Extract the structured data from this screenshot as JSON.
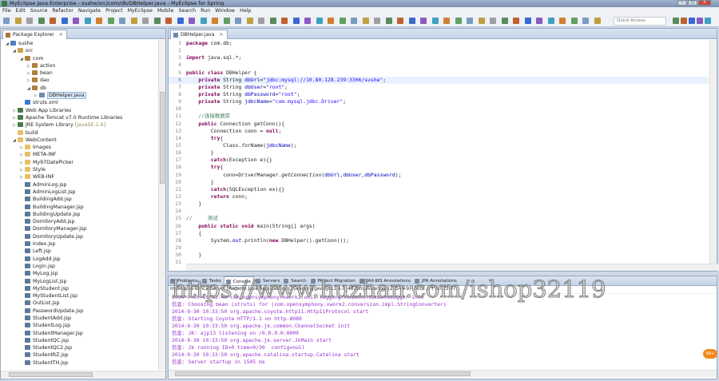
{
  "window": {
    "title": "MyEclipse Java Enterprise - sushe/src/com/db/DBHelper.java - MyEclipse for Spring"
  },
  "menu": [
    "File",
    "Edit",
    "Source",
    "Refactor",
    "Navigate",
    "Project",
    "MyEclipse",
    "Mobile",
    "Search",
    "Run",
    "Window",
    "Help"
  ],
  "toolbar": {
    "quick_access_placeholder": "Quick Access"
  },
  "package_explorer": {
    "tab": "Package Explorer",
    "nodes": [
      {
        "label": "sushe",
        "depth": 0,
        "tw": "◢",
        "icon": "project",
        "color": "#4a7fc0"
      },
      {
        "label": "src",
        "depth": 1,
        "tw": "◢",
        "icon": "source-folder",
        "color": "#c8a050"
      },
      {
        "label": "com",
        "depth": 2,
        "tw": "◢",
        "icon": "package",
        "color": "#b08040"
      },
      {
        "label": "action",
        "depth": 3,
        "tw": "▷",
        "icon": "package",
        "color": "#b08040"
      },
      {
        "label": "bean",
        "depth": 3,
        "tw": "▷",
        "icon": "package",
        "color": "#b08040"
      },
      {
        "label": "dao",
        "depth": 3,
        "tw": "▷",
        "icon": "package",
        "color": "#b08040"
      },
      {
        "label": "db",
        "depth": 3,
        "tw": "◢",
        "icon": "package",
        "color": "#b08040"
      },
      {
        "label": "DBHelper.java",
        "depth": 4,
        "tw": "▷",
        "icon": "java-file",
        "color": "#6a8ab0",
        "selected": true
      },
      {
        "label": "struts.xml",
        "depth": 2,
        "tw": "",
        "icon": "xml-file",
        "color": "#3a7ad0"
      },
      {
        "label": "Web App Libraries",
        "depth": 1,
        "tw": "▷",
        "icon": "library",
        "color": "#4a7a4a"
      },
      {
        "label": "Apache Tomcat v7.0 Runtime Libraries",
        "depth": 1,
        "tw": "▷",
        "icon": "library",
        "color": "#4a7a4a"
      },
      {
        "label": "JRE System Library",
        "extra": "[JavaSE-1.6]",
        "depth": 1,
        "tw": "▷",
        "icon": "library",
        "color": "#4a7a4a"
      },
      {
        "label": "build",
        "depth": 1,
        "tw": "",
        "icon": "folder",
        "color": "#e8c060"
      },
      {
        "label": "WebContent",
        "depth": 1,
        "tw": "◢",
        "icon": "folder",
        "color": "#e8c060"
      },
      {
        "label": "Images",
        "depth": 2,
        "tw": "▷",
        "icon": "folder",
        "color": "#e8c060"
      },
      {
        "label": "META-INF",
        "depth": 2,
        "tw": "▷",
        "icon": "folder",
        "color": "#e8c060"
      },
      {
        "label": "My97DatePicker",
        "depth": 2,
        "tw": "▷",
        "icon": "folder",
        "color": "#e8c060"
      },
      {
        "label": "Style",
        "depth": 2,
        "tw": "▷",
        "icon": "folder",
        "color": "#e8c060"
      },
      {
        "label": "WEB-INF",
        "depth": 2,
        "tw": "▷",
        "icon": "folder",
        "color": "#e8c060"
      },
      {
        "label": "AdminLog.jsp",
        "depth": 2,
        "tw": "",
        "icon": "jsp-file",
        "color": "#5a7a9a"
      },
      {
        "label": "AdminLogList.jsp",
        "depth": 2,
        "tw": "",
        "icon": "jsp-file",
        "color": "#5a7a9a"
      },
      {
        "label": "BuildingAdd.jsp",
        "depth": 2,
        "tw": "",
        "icon": "jsp-file",
        "color": "#5a7a9a"
      },
      {
        "label": "BuildingManager.jsp",
        "depth": 2,
        "tw": "",
        "icon": "jsp-file",
        "color": "#5a7a9a"
      },
      {
        "label": "BuildingUpdate.jsp",
        "depth": 2,
        "tw": "",
        "icon": "jsp-file",
        "color": "#5a7a9a"
      },
      {
        "label": "DomitoryAdd.jsp",
        "depth": 2,
        "tw": "",
        "icon": "jsp-file",
        "color": "#5a7a9a"
      },
      {
        "label": "DomitoryManager.jsp",
        "depth": 2,
        "tw": "",
        "icon": "jsp-file",
        "color": "#5a7a9a"
      },
      {
        "label": "DomitoryUpdate.jsp",
        "depth": 2,
        "tw": "",
        "icon": "jsp-file",
        "color": "#5a7a9a"
      },
      {
        "label": "Index.jsp",
        "depth": 2,
        "tw": "",
        "icon": "jsp-file",
        "color": "#5a7a9a"
      },
      {
        "label": "Left.jsp",
        "depth": 2,
        "tw": "",
        "icon": "jsp-file",
        "color": "#5a7a9a"
      },
      {
        "label": "LogAdd.jsp",
        "depth": 2,
        "tw": "",
        "icon": "jsp-file",
        "color": "#5a7a9a"
      },
      {
        "label": "Login.jsp",
        "depth": 2,
        "tw": "",
        "icon": "jsp-file",
        "color": "#5a7a9a"
      },
      {
        "label": "MyLog.jsp",
        "depth": 2,
        "tw": "",
        "icon": "jsp-file",
        "color": "#5a7a9a"
      },
      {
        "label": "MyLogList.jsp",
        "depth": 2,
        "tw": "",
        "icon": "jsp-file",
        "color": "#5a7a9a"
      },
      {
        "label": "MyStudent.jsp",
        "depth": 2,
        "tw": "",
        "icon": "jsp-file",
        "color": "#5a7a9a"
      },
      {
        "label": "MyStudentList.jsp",
        "depth": 2,
        "tw": "",
        "icon": "jsp-file",
        "color": "#5a7a9a"
      },
      {
        "label": "OutList.jsp",
        "depth": 2,
        "tw": "",
        "icon": "jsp-file",
        "color": "#5a7a9a"
      },
      {
        "label": "PasswordUpdate.jsp",
        "depth": 2,
        "tw": "",
        "icon": "jsp-file",
        "color": "#5a7a9a"
      },
      {
        "label": "StudentAdd.jsp",
        "depth": 2,
        "tw": "",
        "icon": "jsp-file",
        "color": "#5a7a9a"
      },
      {
        "label": "StudentLog.jsp",
        "depth": 2,
        "tw": "",
        "icon": "jsp-file",
        "color": "#5a7a9a"
      },
      {
        "label": "StudentManager.jsp",
        "depth": 2,
        "tw": "",
        "icon": "jsp-file",
        "color": "#5a7a9a"
      },
      {
        "label": "StudentQC.jsp",
        "depth": 2,
        "tw": "",
        "icon": "jsp-file",
        "color": "#5a7a9a"
      },
      {
        "label": "StudentQC2.jsp",
        "depth": 2,
        "tw": "",
        "icon": "jsp-file",
        "color": "#5a7a9a"
      },
      {
        "label": "StudentRZ.jsp",
        "depth": 2,
        "tw": "",
        "icon": "jsp-file",
        "color": "#5a7a9a"
      },
      {
        "label": "StudentTH.jsp",
        "depth": 2,
        "tw": "",
        "icon": "jsp-file",
        "color": "#5a7a9a"
      }
    ]
  },
  "editor": {
    "tab": "DBHelper.java",
    "current_line": 6,
    "lines": [
      [
        [
          "package",
          "kw"
        ],
        [
          " com.db;",
          ""
        ]
      ],
      [],
      [
        [
          "import",
          "kw"
        ],
        [
          " java.sql.*;",
          ""
        ]
      ],
      [],
      [
        [
          "public class",
          "kw"
        ],
        [
          " DBHelper {",
          ""
        ]
      ],
      [
        [
          "    "
        ],
        [
          "private",
          "kw"
        ],
        [
          " String ",
          ""
        ],
        [
          "dbUrl",
          "fld"
        ],
        [
          "=",
          ""
        ],
        [
          "\"jdbc:mysql://10.80.128.239:3306/sushe\"",
          "str"
        ],
        [
          ";",
          ""
        ]
      ],
      [
        [
          "    "
        ],
        [
          "private",
          "kw"
        ],
        [
          " String ",
          ""
        ],
        [
          "dbUser",
          "fld"
        ],
        [
          "=",
          ""
        ],
        [
          "\"root\"",
          "str"
        ],
        [
          ";",
          ""
        ]
      ],
      [
        [
          "    "
        ],
        [
          "private",
          "kw"
        ],
        [
          " String ",
          ""
        ],
        [
          "dbPassword",
          "fld"
        ],
        [
          "=",
          ""
        ],
        [
          "\"root\"",
          "str"
        ],
        [
          ";",
          ""
        ]
      ],
      [
        [
          "    "
        ],
        [
          "private",
          "kw"
        ],
        [
          " String ",
          ""
        ],
        [
          "jdbcName",
          "fld"
        ],
        [
          "=",
          ""
        ],
        [
          "\"com.mysql.jdbc.Driver\"",
          "str"
        ],
        [
          ";",
          ""
        ]
      ],
      [],
      [
        [
          "    "
        ],
        [
          "//连接数据库",
          "cm"
        ]
      ],
      [
        [
          "    "
        ],
        [
          "public",
          "kw"
        ],
        [
          " Connection getConn(){",
          ""
        ]
      ],
      [
        [
          "        Connection conn = ",
          ""
        ],
        [
          "null",
          "kw"
        ],
        [
          ";",
          ""
        ]
      ],
      [
        [
          "        "
        ],
        [
          "try",
          "kw"
        ],
        [
          "{",
          ""
        ]
      ],
      [
        [
          "            Class.",
          ""
        ],
        [
          "forName",
          "it"
        ],
        [
          "(",
          ""
        ],
        [
          "jdbcName",
          "fld"
        ],
        [
          ");",
          ""
        ]
      ],
      [
        [
          "        }",
          ""
        ]
      ],
      [
        [
          "        "
        ],
        [
          "catch",
          "kw"
        ],
        [
          "(Exception e){}",
          ""
        ]
      ],
      [
        [
          "        "
        ],
        [
          "try",
          "kw"
        ],
        [
          "{",
          ""
        ]
      ],
      [
        [
          "            conn=DriverManager.",
          ""
        ],
        [
          "getConnection",
          "it"
        ],
        [
          "(",
          ""
        ],
        [
          "dbUrl",
          "fld"
        ],
        [
          ",",
          ""
        ],
        [
          "dbUser",
          "fld"
        ],
        [
          ",",
          ""
        ],
        [
          "dbPassword",
          "fld"
        ],
        [
          ");",
          ""
        ]
      ],
      [
        [
          "        }",
          ""
        ]
      ],
      [
        [
          "        "
        ],
        [
          "catch",
          "kw"
        ],
        [
          "(SQLException ex){}",
          ""
        ]
      ],
      [
        [
          "        "
        ],
        [
          "return",
          "kw"
        ],
        [
          " conn;",
          ""
        ]
      ],
      [
        [
          "    }",
          ""
        ]
      ],
      [],
      [
        [
          "//     测试",
          "cm"
        ]
      ],
      [
        [
          "    "
        ],
        [
          "public static void",
          "kw"
        ],
        [
          " main(String[] args)",
          ""
        ]
      ],
      [
        [
          "    {",
          ""
        ]
      ],
      [
        [
          "        System.",
          ""
        ],
        [
          "out",
          "st"
        ],
        [
          ".println(",
          ""
        ],
        [
          "new",
          "kw"
        ],
        [
          " DBHelper().getConn());",
          ""
        ]
      ],
      [],
      [
        [
          "    }",
          ""
        ]
      ],
      [],
      [
        [
          "}",
          ""
        ]
      ]
    ]
  },
  "console": {
    "tabs": [
      "Problems",
      "Tasks",
      "Console",
      "Servers",
      "Search",
      "Project Migration",
      "JAX-WS Annotations",
      "JPA Annotations"
    ],
    "active_tab": "Console",
    "header": "myeclipseTomcatServer [Remote Java Application] C:\\learning\\Java\\jdk1.6.0_43\\bin\\javaw.exe (2014年9月30日 上午10:33:47)",
    "lines": [
      "2014-9-30 10:33:49 com.opensymphony.xwork2.util.logging.commons.CommonsLogger info",
      "信息: Choosing bean (struts) for (com.opensymphony.xwork2.conversion.impl.StringConverter)",
      "2014-9-30 10:33:50 org.apache.coyote.http11.Http11Protocol start",
      "信息: Starting Coyote HTTP/1.1 on http-8080",
      "2014-9-30 10:33:50 org.apache.jk.common.ChannelSocket init",
      "信息: JK: ajp13 listening on /0.0.0.0:8009",
      "2014-9-30 10:33:50 org.apache.jk.server.JkMain start",
      "信息: Jk running ID=0 time=0/30  config=null",
      "2014-9-30 10:33:50 org.apache.catalina.startup.Catalina start",
      "信息: Server startup in 1505 ms"
    ]
  },
  "watermark": "https://www.huzhan.com/ishop32119",
  "badge": "99+"
}
